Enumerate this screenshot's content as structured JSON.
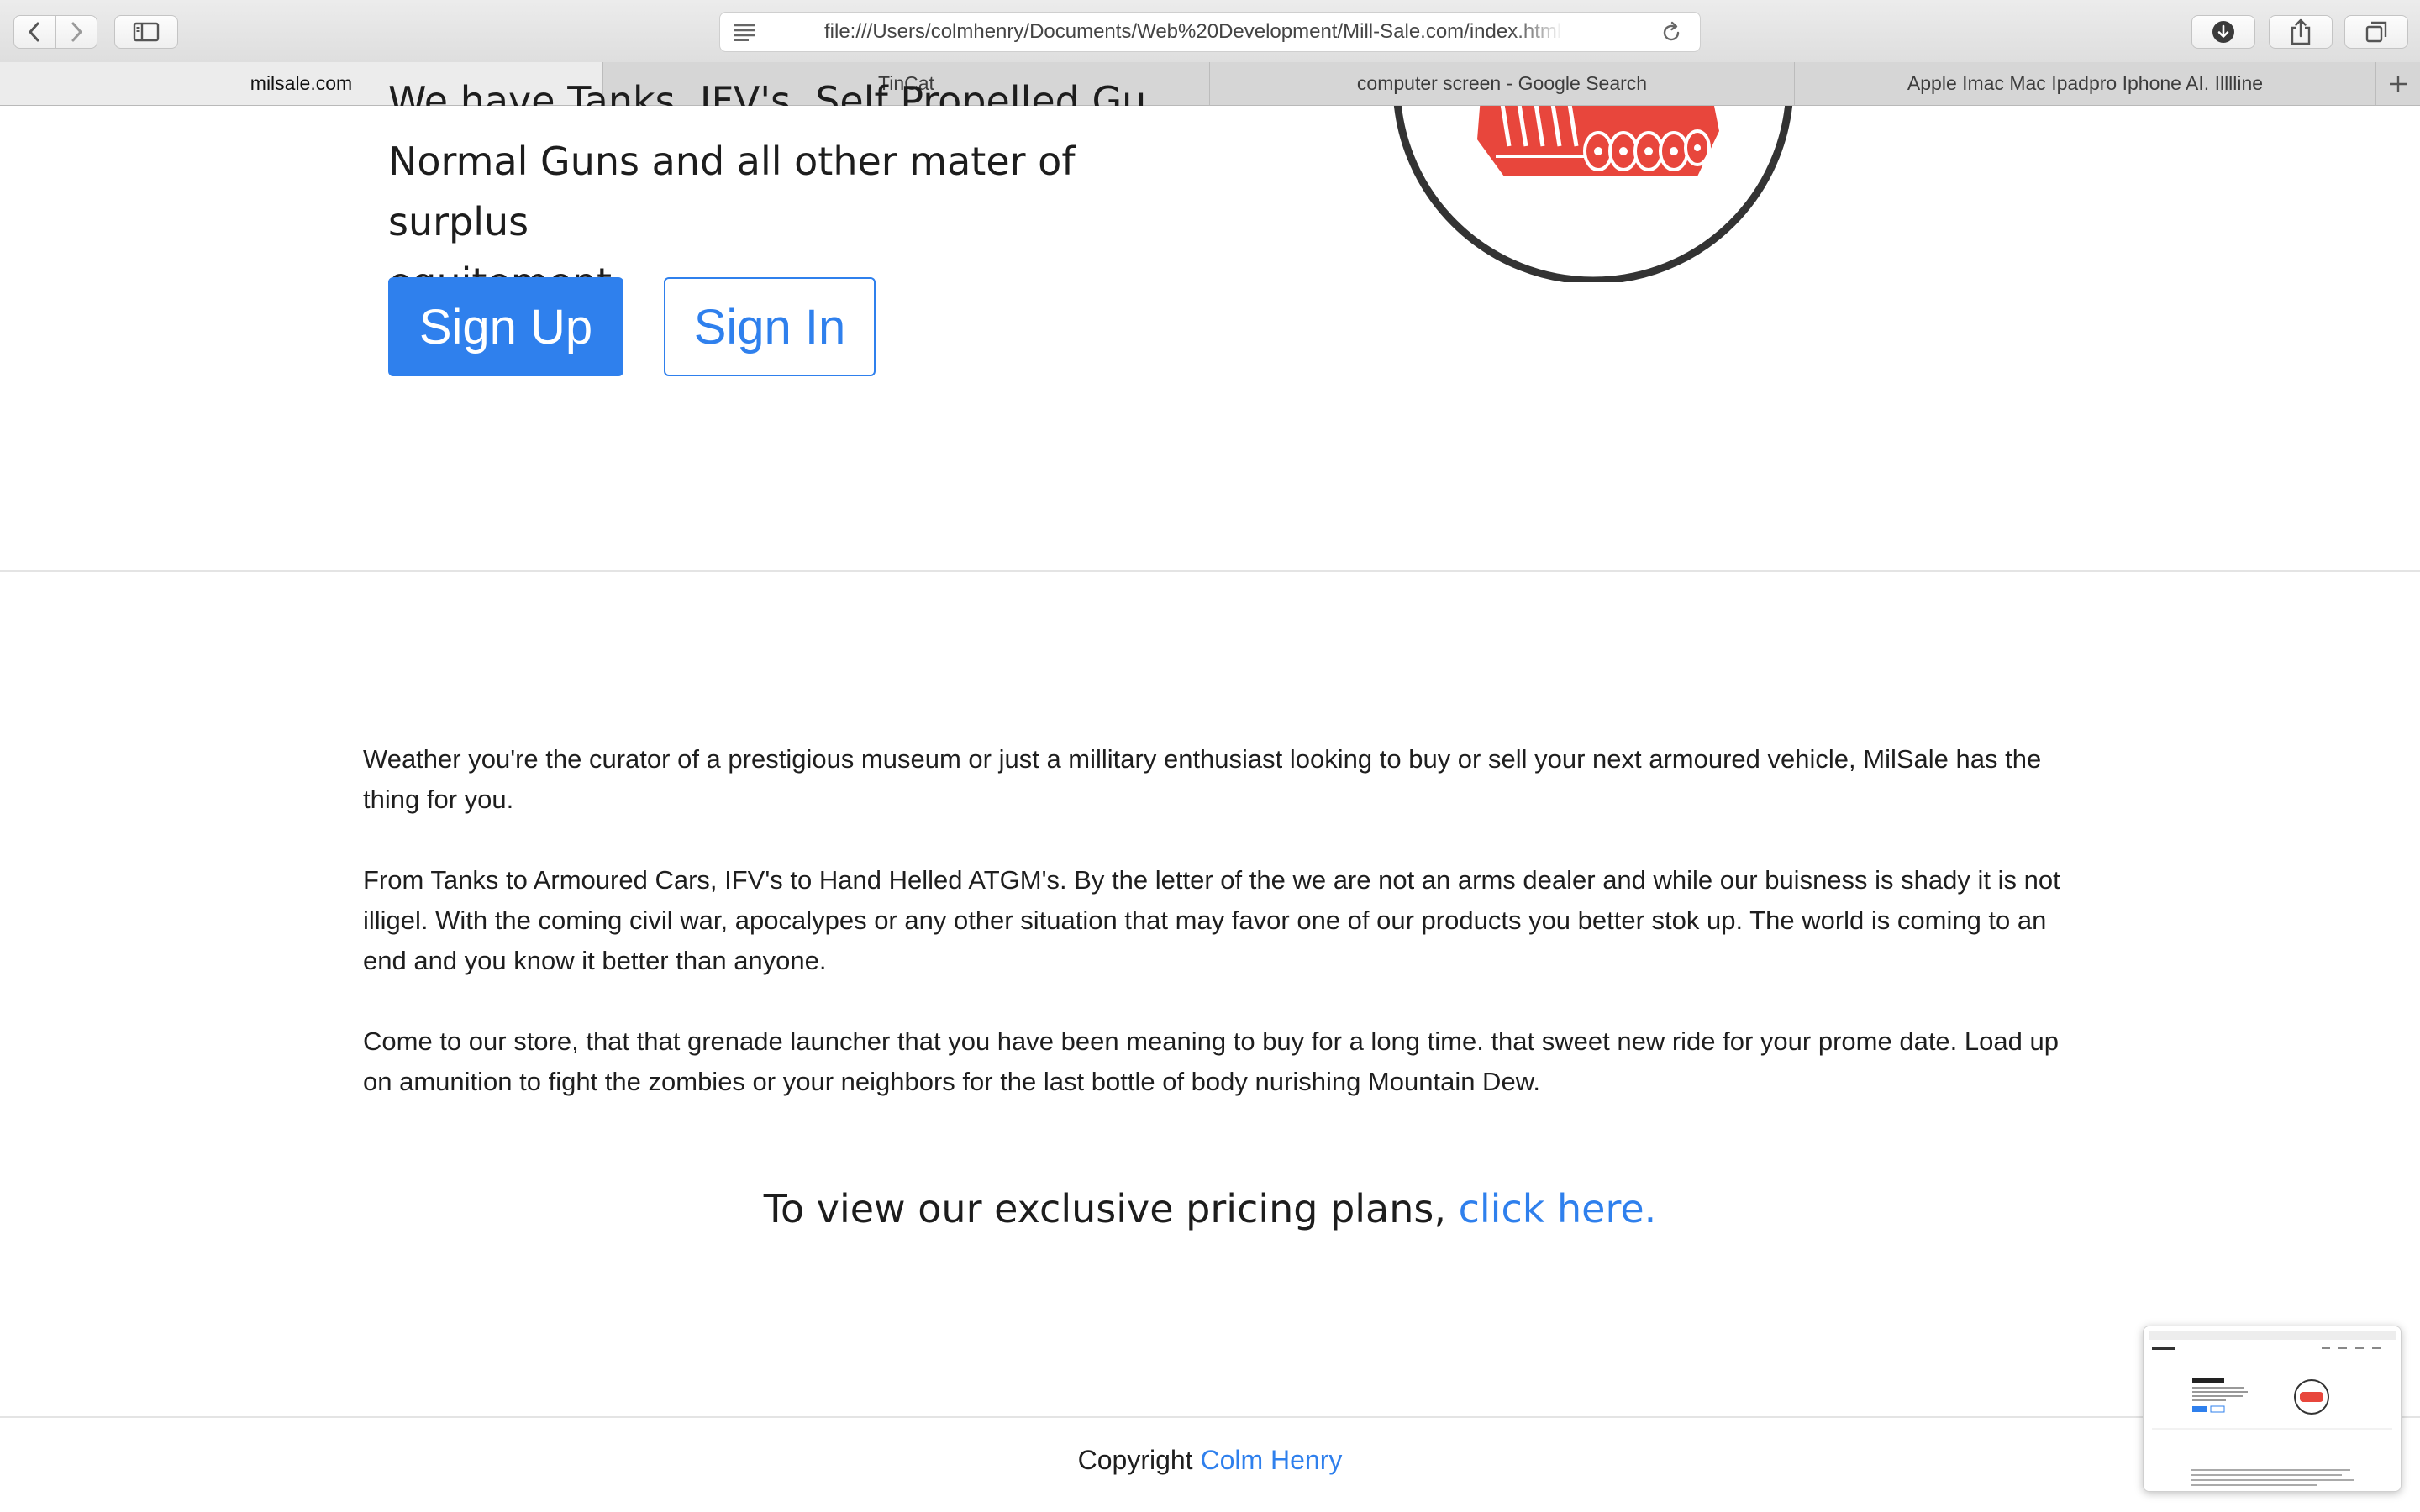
{
  "browser": {
    "url": "file:///Users/colmhenry/Documents/Web%20Development/Mill-Sale.com/index.html",
    "tabs": [
      {
        "label": "milsale.com",
        "active": true
      },
      {
        "label": "TinCat",
        "active": false
      },
      {
        "label": "computer screen - Google Search",
        "active": false
      },
      {
        "label": "Apple Imac Mac Ipadpro Iphone AI. Illlline",
        "active": false
      }
    ]
  },
  "hero": {
    "clipped_line": "We have Tanks, IFV's, Self Propelled Guns,",
    "line2": "Normal Guns and all other mater of surplus",
    "line3": "equitement.",
    "signup_label": "Sign Up",
    "signin_label": "Sign In"
  },
  "content": {
    "paragraphs": [
      "Weather you're the curator of a prestigious museum or just a millitary enthusiast looking to buy or sell your next armoured vehicle, MilSale has the thing for you.",
      "From Tanks to Armoured Cars, IFV's to Hand Helled ATGM's. By the letter of the we are not an arms dealer and while our buisness is shady it is not illigel. With the coming civil war, apocalypes or any other situation that may favor one of our products you better stok up. The world is coming to an end and you know it better than anyone.",
      "Come to our store, that that grenade launcher that you have been meaning to buy for a long time. that sweet new ride for your prome date. Load up on amunition to fight the zombies or your neighbors for the last bottle of body nurishing Mountain Dew."
    ],
    "pricing_text": "To view our exclusive pricing plans, ",
    "pricing_link": "click here."
  },
  "footer": {
    "text": "Copyright ",
    "author": "Colm Henry"
  },
  "colors": {
    "accent": "#2f80ed",
    "logo_red": "#e8463c",
    "logo_ring": "#333333"
  },
  "icons": [
    "back-icon",
    "forward-icon",
    "sidebar-icon",
    "reader-icon",
    "reload-icon",
    "download-icon",
    "share-icon",
    "tabs-icon",
    "plus-icon"
  ]
}
